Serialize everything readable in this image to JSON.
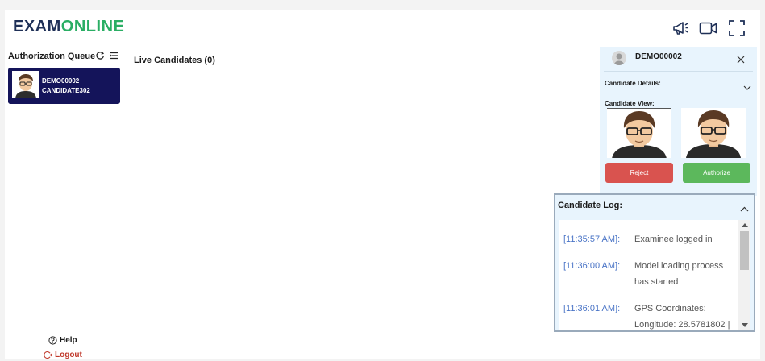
{
  "brand": {
    "part1": "EXAM",
    "part2": "ONLINE"
  },
  "sidebar": {
    "queue_title": "Authorization Queue",
    "candidate": {
      "id": "DEMO00002",
      "name": "CANDIDATE302"
    },
    "help_label": "Help",
    "logout_label": "Logout"
  },
  "main": {
    "live_title": "Live Candidates (0)"
  },
  "panel": {
    "candidate_id": "DEMO00002",
    "details_label": "Candidate Details:",
    "view_label": "Candidate View:",
    "reject_label": "Reject",
    "authorize_label": "Authorize"
  },
  "log": {
    "title": "Candidate Log:",
    "entries": [
      {
        "time": "[11:35:57 AM]:",
        "message": "Examinee logged in"
      },
      {
        "time": "[11:36:00 AM]:",
        "message": "Model loading process has started"
      },
      {
        "time": "[11:36:01 AM]:",
        "message": "GPS Coordinates: Longitude: 28.5781802 |"
      }
    ]
  },
  "colors": {
    "brand_dark": "#1f3057",
    "brand_green": "#2aae64",
    "card_bg": "#14145a",
    "reject": "#d9534f",
    "authorize": "#5cb85c",
    "log_time": "#4a74c6"
  },
  "icons": [
    "refresh-icon",
    "list-filter-icon",
    "megaphone-icon",
    "video-camera-icon",
    "fullscreen-icon",
    "close-icon",
    "chevron-down-icon",
    "chevron-up-icon",
    "help-circle-icon",
    "logout-icon"
  ]
}
